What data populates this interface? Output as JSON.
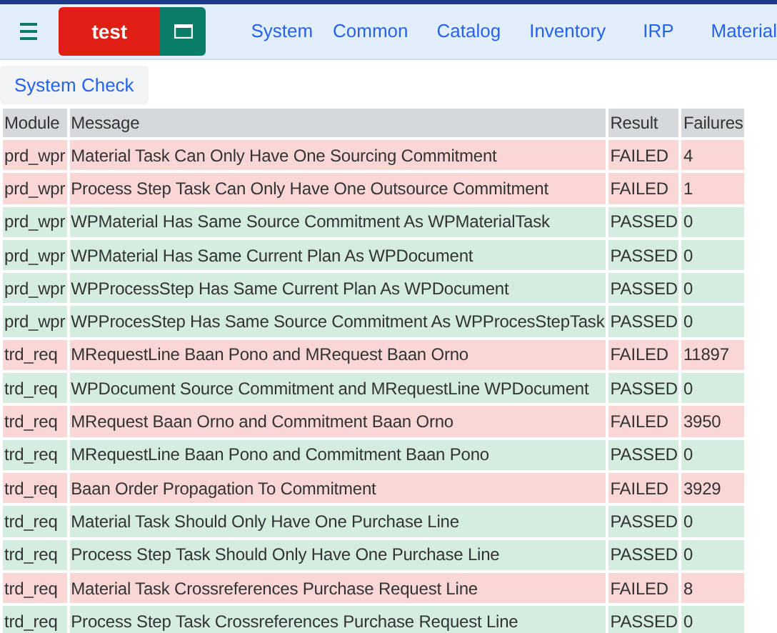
{
  "navbar": {
    "app_button": "test",
    "links": [
      "System",
      "Common",
      "Catalog",
      "Inventory",
      "IRP",
      "Material"
    ]
  },
  "tabs": [
    {
      "label": "System Check",
      "selected": true
    }
  ],
  "table": {
    "columns": [
      "Module",
      "Message",
      "Result",
      "Failures"
    ],
    "rows": [
      {
        "module": "prd_wpr",
        "message": "Material Task Can Only Have One Sourcing Commitment",
        "result": "FAILED",
        "failures": "4",
        "passed": false
      },
      {
        "module": "prd_wpr",
        "message": "Process Step Task Can Only Have One Outsource Commitment",
        "result": "FAILED",
        "failures": "1",
        "passed": false
      },
      {
        "module": "prd_wpr",
        "message": "WPMaterial Has Same Source Commitment As WPMaterialTask",
        "result": "PASSED",
        "failures": "0",
        "passed": true
      },
      {
        "module": "prd_wpr",
        "message": "WPMaterial Has Same Current Plan As WPDocument",
        "result": "PASSED",
        "failures": "0",
        "passed": true
      },
      {
        "module": "prd_wpr",
        "message": "WPProcessStep Has Same Current Plan As WPDocument",
        "result": "PASSED",
        "failures": "0",
        "passed": true
      },
      {
        "module": "prd_wpr",
        "message": "WPProcesStep Has Same Source Commitment As WPProcesStepTask",
        "result": "PASSED",
        "failures": "0",
        "passed": true
      },
      {
        "module": "trd_req",
        "message": "MRequestLine Baan Pono and MRequest Baan Orno",
        "result": "FAILED",
        "failures": "11897",
        "passed": false
      },
      {
        "module": "trd_req",
        "message": "WPDocument Source Commitment and MRequestLine WPDocument",
        "result": "PASSED",
        "failures": "0",
        "passed": true
      },
      {
        "module": "trd_req",
        "message": "MRequest Baan Orno and Commitment Baan Orno",
        "result": "FAILED",
        "failures": "3950",
        "passed": false
      },
      {
        "module": "trd_req",
        "message": "MRequestLine Baan Pono and Commitment Baan Pono",
        "result": "PASSED",
        "failures": "0",
        "passed": true
      },
      {
        "module": "trd_req",
        "message": "Baan Order Propagation To Commitment",
        "result": "FAILED",
        "failures": "3929",
        "passed": false
      },
      {
        "module": "trd_req",
        "message": "Material Task Should Only Have One Purchase Line",
        "result": "PASSED",
        "failures": "0",
        "passed": true
      },
      {
        "module": "trd_req",
        "message": "Process Step Task Should Only Have One Purchase Line",
        "result": "PASSED",
        "failures": "0",
        "passed": true
      },
      {
        "module": "trd_req",
        "message": "Material Task Crossreferences Purchase Request Line",
        "result": "FAILED",
        "failures": "8",
        "passed": false
      },
      {
        "module": "trd_req",
        "message": "Process Step Task Crossreferences Purchase Request Line",
        "result": "PASSED",
        "failures": "0",
        "passed": true
      }
    ]
  }
}
